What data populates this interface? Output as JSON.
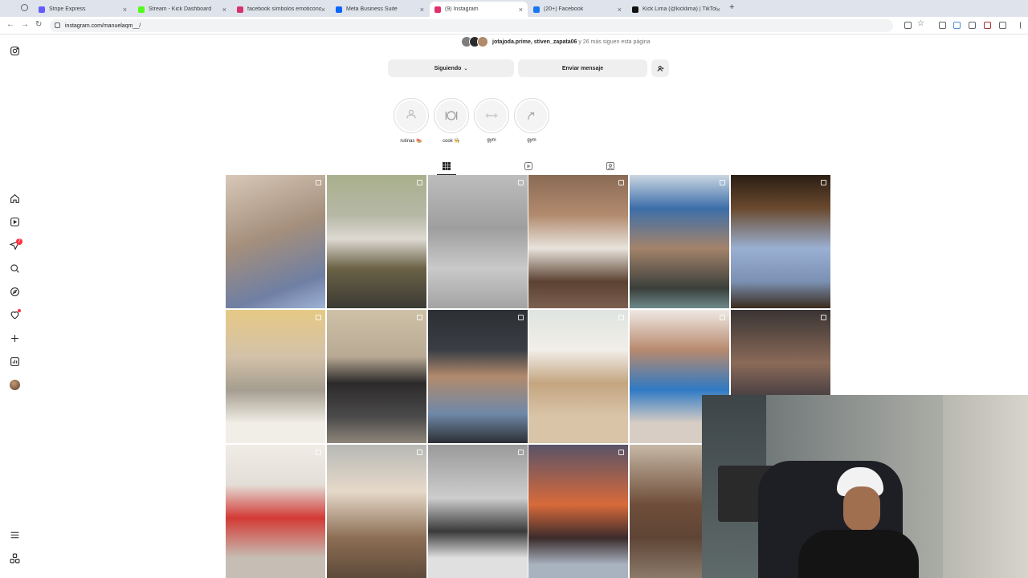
{
  "browser": {
    "tabs": [
      {
        "title": "Stripe Express",
        "color": "#635bff",
        "active": false
      },
      {
        "title": "Stream - Kick Dashboard",
        "color": "#53fc18",
        "active": false
      },
      {
        "title": "facebook símbolos emoticono",
        "color": "#d6336c",
        "active": false
      },
      {
        "title": "Meta Business Suite",
        "color": "#0866ff",
        "active": false
      },
      {
        "title": "(9) Instagram",
        "color": "#e1306c",
        "active": true
      },
      {
        "title": "(20+) Facebook",
        "color": "#1877f2",
        "active": false
      },
      {
        "title": "Kick Lima (@kicklima) | TikTok",
        "color": "#111111",
        "active": false
      }
    ],
    "url": "instagram.com/manuelaqm__/",
    "new_tab_label": "+"
  },
  "sidebar": {
    "items": [
      {
        "name": "instagram-logo-icon"
      },
      {
        "name": "home-icon"
      },
      {
        "name": "reels-icon"
      },
      {
        "name": "messages-icon",
        "badge": "7"
      },
      {
        "name": "search-icon"
      },
      {
        "name": "explore-icon"
      },
      {
        "name": "notifications-icon"
      },
      {
        "name": "create-icon"
      },
      {
        "name": "dashboard-icon"
      },
      {
        "name": "profile-avatar"
      },
      {
        "name": "more-menu-icon"
      },
      {
        "name": "also-from-meta-icon"
      }
    ]
  },
  "profile": {
    "followers_by": "jotajoda.prime, stiven_zapata06",
    "followers_connector": " y ",
    "followers_more": "26 más",
    "followers_suffix": " siguen esta página",
    "following_button": "Siguiendo",
    "message_button": "Enviar mensaje",
    "highlights": [
      {
        "label": "rutinas 🍉"
      },
      {
        "label": "cook 👨‍🍳"
      },
      {
        "label": "gym"
      },
      {
        "label": "gym"
      }
    ],
    "tabs": [
      "posts-grid-icon",
      "reels-tab-icon",
      "tagged-tab-icon"
    ]
  },
  "posts": [
    {
      "bg": "linear-gradient(160deg,#d8c8b8,#a48f7c 45%,#6f7fa3 80%,#9fb3d6)",
      "type": "multi"
    },
    {
      "bg": "linear-gradient(180deg,#a9b08c,#b6b8a6 30%,#ddd9d2 48%,#6b6246 70%,#3b3a34)",
      "type": "multi"
    },
    {
      "bg": "linear-gradient(180deg,#bdbdbd,#9e9e9e 40%,#c9c9c9 70%,#a3a3a3)",
      "type": "multi"
    },
    {
      "bg": "linear-gradient(180deg,#8a6a55,#b28b6e 30%,#e8e3dc 55%,#5c4232 80%,#7b6050)",
      "type": "multi"
    },
    {
      "bg": "linear-gradient(180deg,#c9d6e2,#3d6ea9 25%,#a4836a 55%,#3a3f3b 85%,#6d8a8a)",
      "type": "multi"
    },
    {
      "bg": "linear-gradient(180deg,#2b1e14,#6a4a2e 25%,#9ab0d2 55%,#7b90b3 80%,#3a2a1c)",
      "type": "multi"
    },
    {
      "bg": "linear-gradient(180deg,#e6c985,#d3c2a9 35%,#a59d8f 60%,#f1eee7 85%)",
      "type": "multi"
    },
    {
      "bg": "linear-gradient(180deg,#cfc1a8,#b8a993 35%,#2c2a2a 55%,#4b4a4a 80%,#8d8579)",
      "type": "multi"
    },
    {
      "bg": "linear-gradient(180deg,#2c2f33,#3a3e44 30%,#b28a6c 50%,#6f88a8 78%,#2c2f33)",
      "type": "multi"
    },
    {
      "bg": "linear-gradient(180deg,#dfe4e0,#f2eee9 30%,#c4a580 55%,#d9c4a8 80%)",
      "type": "multi"
    },
    {
      "bg": "linear-gradient(180deg,#efe9e4,#b88a6e 30%,#2f7ac4 60%,#d8cdc4 85%)",
      "type": "multi"
    },
    {
      "bg": "linear-gradient(180deg,#3a3434,#8a6a58 40%,#2f2f3a 75%)",
      "type": "multi"
    },
    {
      "bg": "linear-gradient(180deg,#f0ece6,#e3ded7 30%,#d33a35 55%,#c6beb4 85%)",
      "type": "multi"
    },
    {
      "bg": "linear-gradient(180deg,#b7b9b6,#e6d9c9 35%,#8c6e54 70%,#5e4a3a)",
      "type": "multi"
    },
    {
      "bg": "linear-gradient(180deg,#9a9a9a,#cdcdcd 40%,#3a3a3a 65%,#e0e0e0 85%)",
      "type": "multi"
    },
    {
      "bg": "linear-gradient(180deg,#5a5368,#d86a3a 45%,#3b2b2b 70%,#a9b3c0 90%)",
      "type": "reel"
    },
    {
      "bg": "linear-gradient(180deg,#c7b8a6,#6e4e3a 45%,#5f4536 70%,#8c7a6a)",
      "type": "multi"
    }
  ]
}
